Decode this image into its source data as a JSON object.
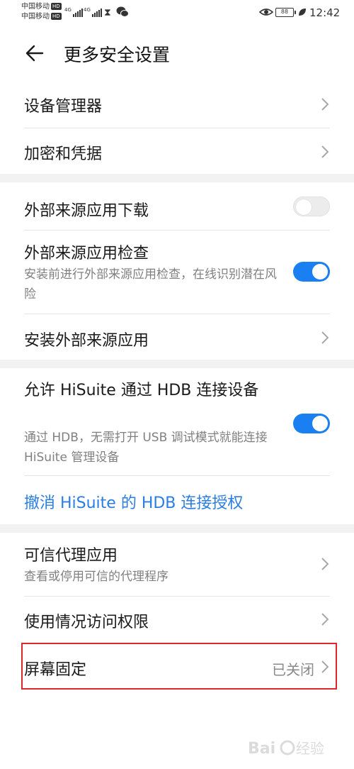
{
  "status_bar": {
    "carrier1": "中国移动",
    "carrier2": "中国移动",
    "hd_badge": "HD",
    "net1": "4G",
    "net2": "4G",
    "battery": "88",
    "time": "12:42"
  },
  "header": {
    "title": "更多安全设置"
  },
  "items": {
    "device_manager": "设备管理器",
    "encryption": "加密和凭据",
    "external_download": "外部来源应用下载",
    "external_check": "外部来源应用检查",
    "external_check_desc": "安装前进行外部来源应用检查，在线识别潜在风险",
    "install_external": "安装外部来源应用",
    "hisuite_hdb": "允许 HiSuite 通过 HDB 连接设备",
    "hisuite_hdb_desc": "通过 HDB，无需打开 USB 调试模式就能连接 HiSuite 管理设备",
    "revoke_hdb": "撤消 HiSuite 的 HDB 连接授权",
    "trust_agents": "可信代理应用",
    "trust_agents_desc": "查看或停用可信的代理程序",
    "usage_access": "使用情况访问权限",
    "screen_pinning": "屏幕固定",
    "screen_pinning_value": "已关闭"
  },
  "toggles": {
    "external_download": false,
    "external_check": true,
    "hisuite_hdb": true
  },
  "colors": {
    "accent": "#1a7ff0",
    "link": "#2a7de1",
    "highlight_border": "#d9272e"
  }
}
